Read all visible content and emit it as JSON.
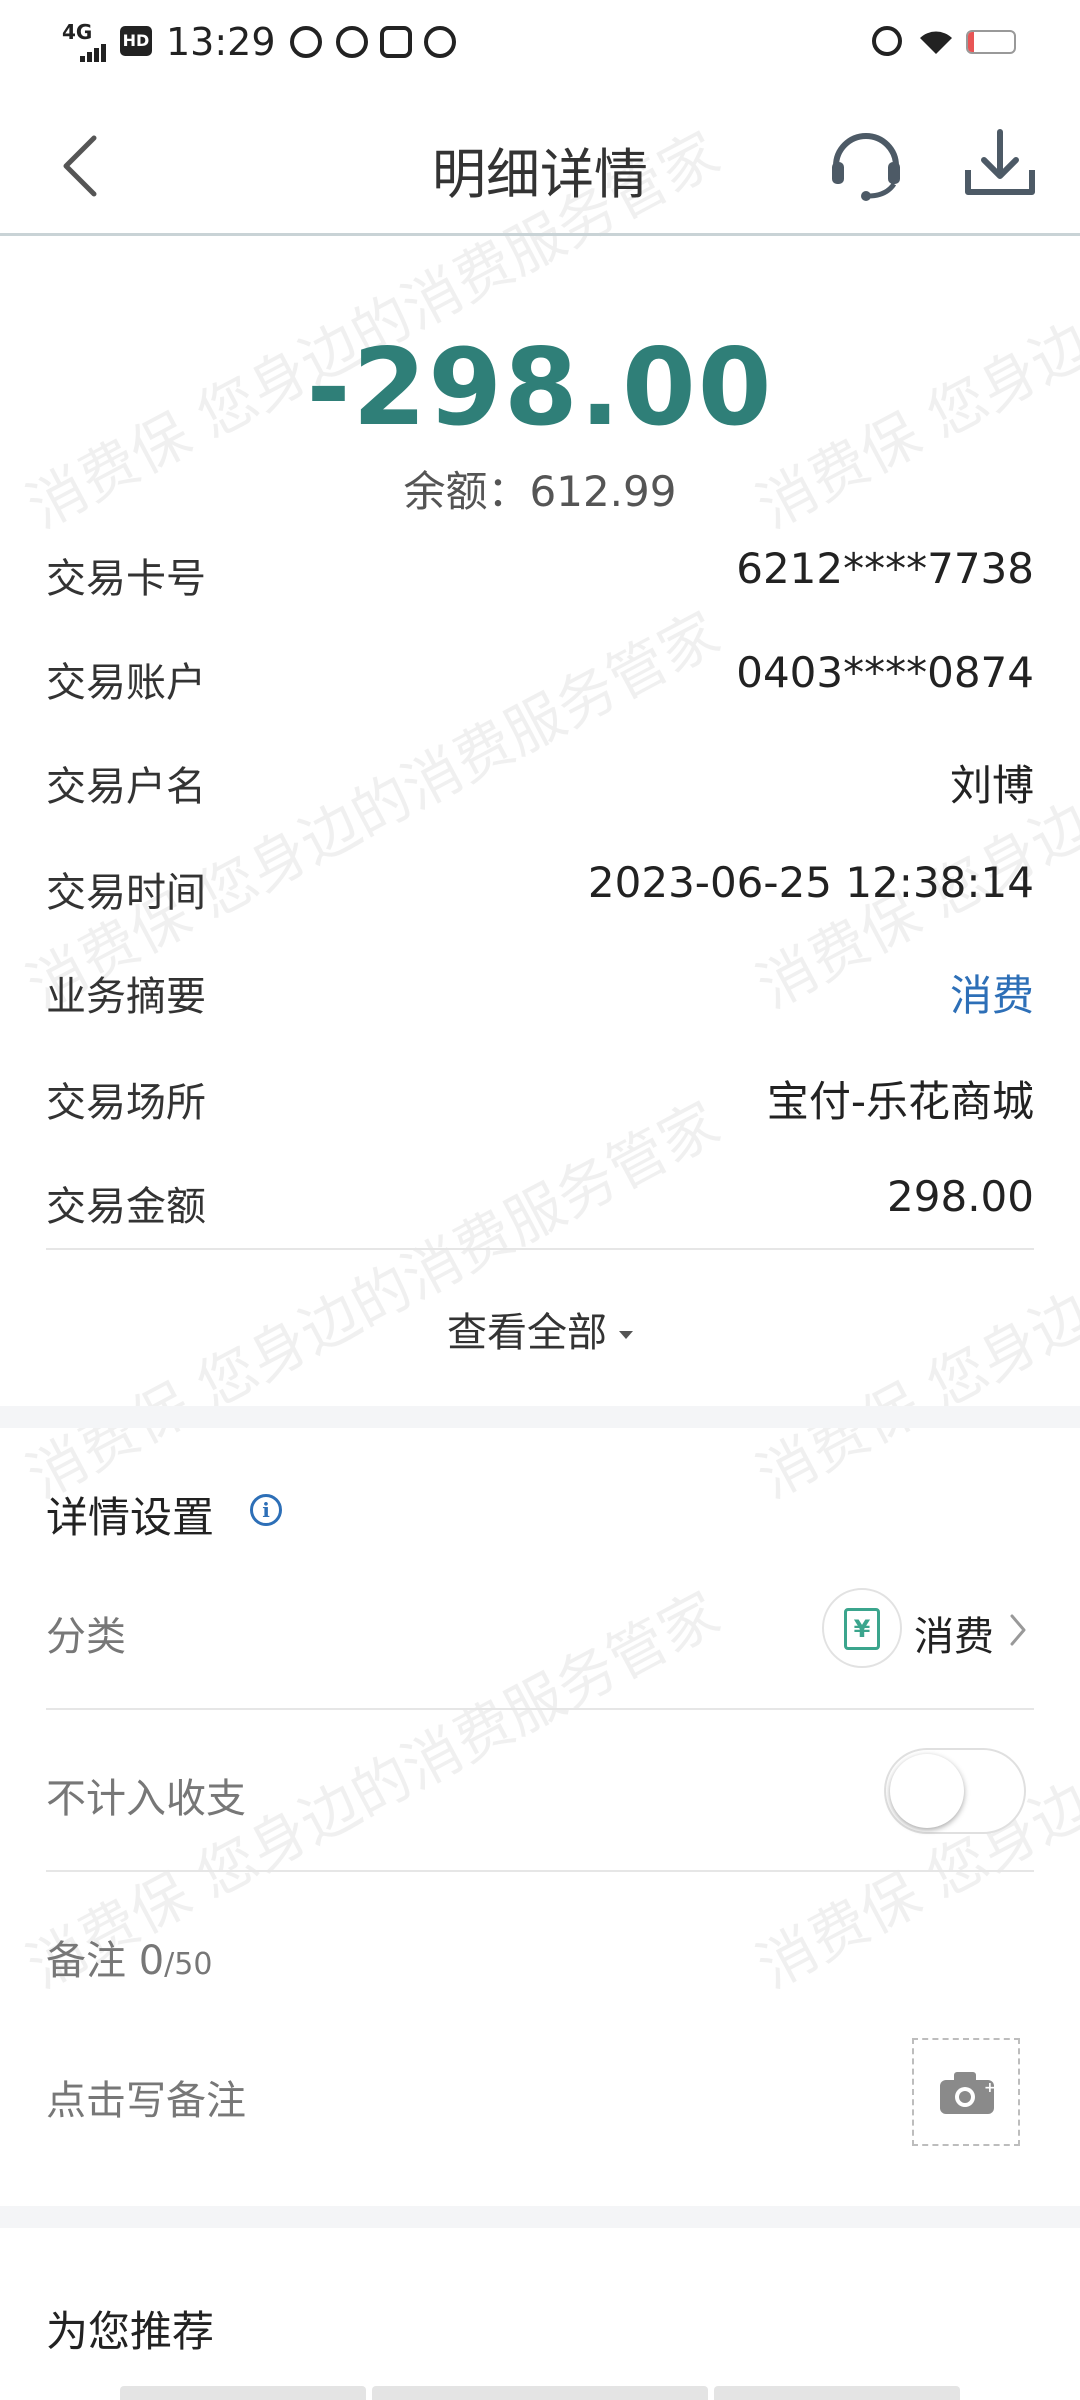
{
  "status_bar": {
    "time": "13:29",
    "network": "4G",
    "hd": "HD",
    "battery": "14",
    "battery_level_percent": 14
  },
  "header": {
    "title": "明细详情",
    "back_icon": "chevron-left-icon",
    "service_icon": "headset-icon",
    "download_icon": "download-icon"
  },
  "summary": {
    "amount": "-298.00",
    "balance": "余额：612.99",
    "amount_color": "#2f7f78"
  },
  "details": [
    {
      "label": "交易卡号",
      "value": "6212****7738"
    },
    {
      "label": "交易账户",
      "value": "0403****0874"
    },
    {
      "label": "交易户名",
      "value": "刘博"
    },
    {
      "label": "交易时间",
      "value": "2023-06-25 12:38:14"
    },
    {
      "label": "业务摘要",
      "value": "消费"
    },
    {
      "label": "交易场所",
      "value": "宝付-乐花商城"
    },
    {
      "label": "交易金额",
      "value": "298.00"
    }
  ],
  "view_all": "查看全部",
  "settings": {
    "title": "详情设置",
    "category_label": "分类",
    "category_icon_glyph": "¥",
    "category_value": "消费",
    "exclude_label": "不计入收支",
    "exclude_enabled": false,
    "note_label": "备注",
    "note_count": "0",
    "note_max": "/50",
    "note_placeholder": "点击写备注"
  },
  "recommend": {
    "title": "为您推荐"
  },
  "watermark": "消费保 您身边的消费服务管家",
  "colors": {
    "link": "#2d6fb7",
    "accent": "#3ba58d"
  }
}
